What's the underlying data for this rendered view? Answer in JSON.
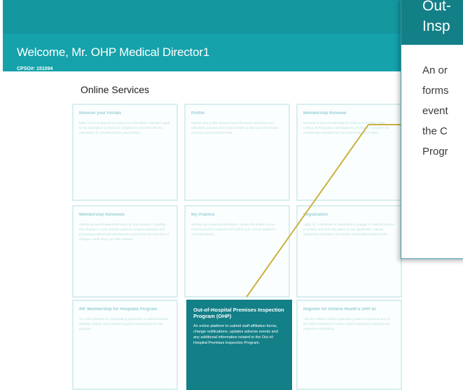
{
  "header": {
    "welcome": "Welcome, Mr. OHP Medical Director1",
    "cpso": "CPSO#: 151094"
  },
  "services": {
    "title": "Online Services",
    "cards": [
      {
        "title": "Reserve your Portals",
        "desc": "Make a secure payment to keep your information reviewed, apply for an exemption or read your compliance overview with the submission of completed forms and policies.",
        "highlight": false
      },
      {
        "title": "Profile",
        "desc": "Update your profile and personal information including your education, practice and contact details so that your information remains current and accurate.",
        "highlight": false
      },
      {
        "title": "Membership Renewal",
        "desc": "Renewal of your membership is a duty as a member of the College of Physicians and Surgeons of Ontario. Complete the membership renewal form and submit payment online.",
        "highlight": false
      },
      {
        "title": "Membership Renewals",
        "desc": "Submit annual renewal information for your practice, including any changes to your practice address, hospital privileges and continuing professional development and review the summary of changes made since your last renewal.",
        "highlight": false
      },
      {
        "title": "My Practice",
        "desc": "Manage your practice information, update the details of your current practice locations and confirm your contact details for correspondence.",
        "highlight": false
      },
      {
        "title": "Registration",
        "desc": "Apply for a certificate of registration to engage in medical practice in Ontario and track the status of your application, upload supporting documents and review outstanding requirements.",
        "highlight": false
      },
      {
        "title": "IHF Membership for Hospitals Program",
        "desc": "An online platform for participating physicians to submit hospital affiliation details and complete required assessments for this program.",
        "highlight": false
      },
      {
        "title": "Out-of-Hospital Premises Inspection Program (OHP)",
        "desc": "An online platform to submit staff affiliation forms, change notifications, updates adverse events and any additional information related to the Out-of-Hospital Premises Inspection Program.",
        "highlight": true
      },
      {
        "title": "Register for Ontario Health's OHP ID",
        "desc": "Visit the Ontario Health registration portal to request access to the online submission system used for premises reporting and inspection scheduling.",
        "highlight": false
      }
    ]
  },
  "zoom": {
    "title_line1": "Out-",
    "title_line2": "Insp",
    "body_lines": [
      "An or",
      "forms",
      "event",
      "the C",
      "Progr"
    ]
  },
  "colors": {
    "header": "#1597a0",
    "band": "#15a2ab",
    "highlight_card": "#137f87",
    "callout_line": "#c9b23f"
  }
}
